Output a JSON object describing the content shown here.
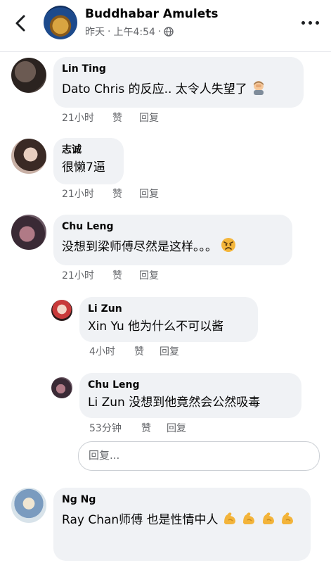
{
  "header": {
    "title": "Buddhabar Amulets",
    "date": "昨天",
    "sep": "·",
    "time": "上午4:54",
    "sep2": "·"
  },
  "comments": [
    {
      "author": "Lin Ting",
      "text": "Dato Chris 的反应.. 太令人失望了",
      "emoji": "man-facepalming-emoji",
      "time": "21小时",
      "like": "赞",
      "reply": "回复"
    },
    {
      "author": "志诚",
      "text": "很懒7逼",
      "time": "21小时",
      "like": "赞",
      "reply": "回复"
    },
    {
      "author": "Chu Leng",
      "text": "没想到梁师傅尽然是这样。。。",
      "emoji": "angry-face-emoji",
      "time": "21小时",
      "like": "赞",
      "reply": "回复"
    }
  ],
  "replies": [
    {
      "author": "Li Zun",
      "text": "Xin Yu 他为什么不可以酱",
      "time": "4小时",
      "like": "赞",
      "reply": "回复"
    },
    {
      "author": "Chu Leng",
      "text": "Li Zun 没想到他竟然会公然吸毒",
      "time": "53分钟",
      "like": "赞",
      "reply": "回复"
    }
  ],
  "reply_input": {
    "placeholder": "回复..."
  },
  "last_comment": {
    "author": "Ng Ng",
    "text": "Ray Chan师傅 也是性情中人",
    "emoji": "flexed-biceps-emoji"
  }
}
